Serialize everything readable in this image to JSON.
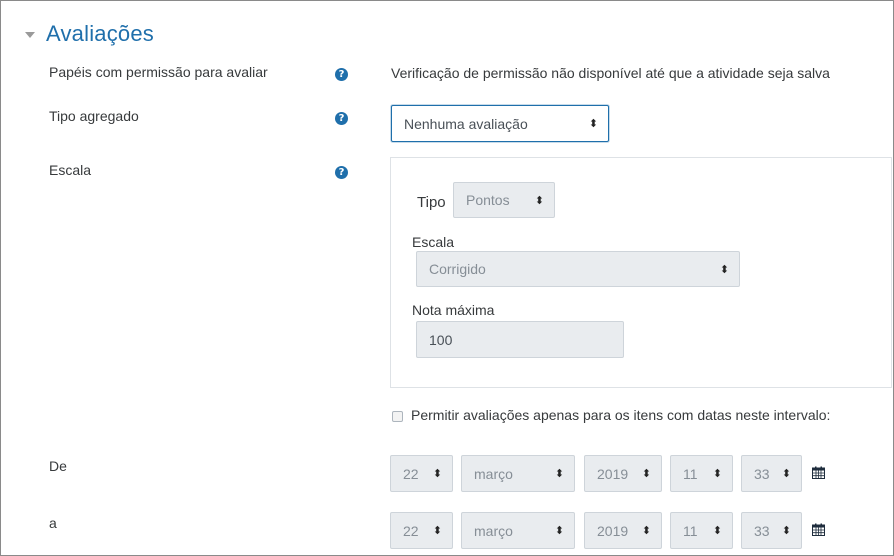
{
  "section": {
    "title": "Avaliações"
  },
  "fields": {
    "roles": {
      "label": "Papéis com permissão para avaliar",
      "value": "Verificação de permissão não disponível até que a atividade seja salva"
    },
    "aggregate": {
      "label": "Tipo agregado",
      "selected": "Nenhuma avaliação"
    },
    "scale": {
      "label": "Escala",
      "type_label": "Tipo",
      "type_selected": "Pontos",
      "scale_label": "Escala",
      "scale_selected": "Corrigido",
      "max_label": "Nota máxima",
      "max_value": "100"
    },
    "restrict": {
      "label": "Permitir avaliações apenas para os itens com datas neste intervalo:"
    },
    "from": {
      "label": "De",
      "day": "22",
      "month": "março",
      "year": "2019",
      "hour": "11",
      "minute": "33"
    },
    "to": {
      "label": "a",
      "day": "22",
      "month": "março",
      "year": "2019",
      "hour": "11",
      "minute": "33"
    }
  },
  "icons": {
    "help": "question-circle-icon",
    "calendar": "calendar-icon",
    "collapse": "caret-down-icon"
  },
  "colors": {
    "accent": "#1f6fab",
    "disabled_bg": "#e9ecef",
    "text": "#373a3c"
  }
}
